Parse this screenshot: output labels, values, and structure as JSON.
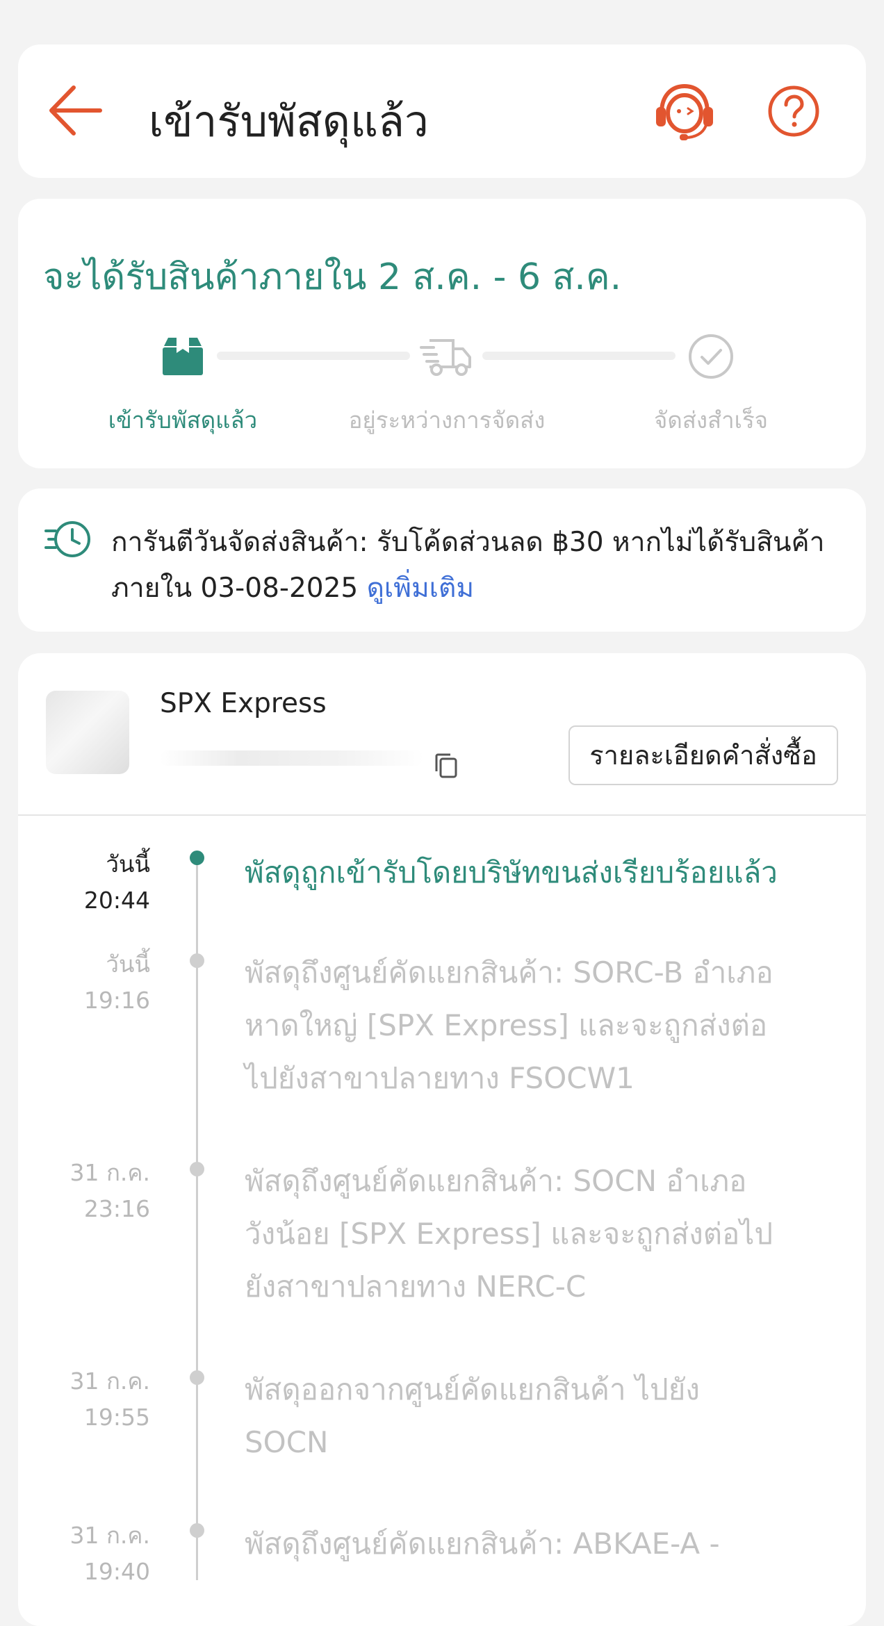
{
  "header": {
    "title": "เข้ารับพัสดุแล้ว"
  },
  "status": {
    "eta": "จะได้รับสินค้าภายใน 2 ส.ค. - 6 ส.ค.",
    "steps": [
      {
        "label": "เข้ารับพัสดุแล้ว",
        "state": "completed"
      },
      {
        "label": "อยู่ระหว่างการจัดส่ง",
        "state": "pending"
      },
      {
        "label": "จัดส่งสำเร็จ",
        "state": "pending"
      }
    ]
  },
  "guarantee": {
    "line1": "การันตีวันจัดส่งสินค้า: รับโค้ดส่วนลด ฿30 หากไม่ได้รับสินค้า",
    "line2_prefix": "ภายใน 03-08-2025 ",
    "see_more": "ดูเพิ่มเติม"
  },
  "shipment": {
    "carrier": "SPX Express",
    "order_detail_button": "รายละเอียดคำสั่งซื้อ"
  },
  "events": [
    {
      "date": "วันนี้",
      "time": "20:44",
      "lines": [
        "พัสดุถูกเข้ารับโดยบริษัทขนส่งเรียบร้อยแล้ว"
      ],
      "active": true
    },
    {
      "date": "วันนี้",
      "time": "19:16",
      "lines": [
        "พัสดุถึงศูนย์คัดแยกสินค้า: SORC-B อำเภอ",
        "หาดใหญ่ [SPX Express] และจะถูกส่งต่อ",
        "ไปยังสาขาปลายทาง FSOCW1"
      ],
      "active": false
    },
    {
      "date": "31 ก.ค.",
      "time": "23:16",
      "lines": [
        "พัสดุถึงศูนย์คัดแยกสินค้า: SOCN อำเภอ",
        "วังน้อย [SPX Express] และจะถูกส่งต่อไป",
        "ยังสาขาปลายทาง NERC-C"
      ],
      "active": false
    },
    {
      "date": "31 ก.ค.",
      "time": "19:55",
      "lines": [
        "พัสดุออกจากศูนย์คัดแยกสินค้า ไปยัง",
        "SOCN"
      ],
      "active": false
    },
    {
      "date": "31 ก.ค.",
      "time": "19:40",
      "lines": [
        "พัสดุถึงศูนย์คัดแยกสินค้า: ABKAE-A -"
      ],
      "active": false
    }
  ],
  "colors": {
    "accent_green": "#2e8b7a",
    "accent_orange": "#e2552f",
    "link_blue": "#3f6fd6",
    "inactive_gray": "#c2c2c2"
  },
  "icons": {
    "back": "arrow-left-icon",
    "support": "headset-support-icon",
    "help": "question-circle-icon",
    "step1": "package-box-icon",
    "step2": "truck-icon",
    "step3": "check-circle-icon",
    "guarantee": "fast-clock-icon",
    "copy": "copy-icon"
  }
}
